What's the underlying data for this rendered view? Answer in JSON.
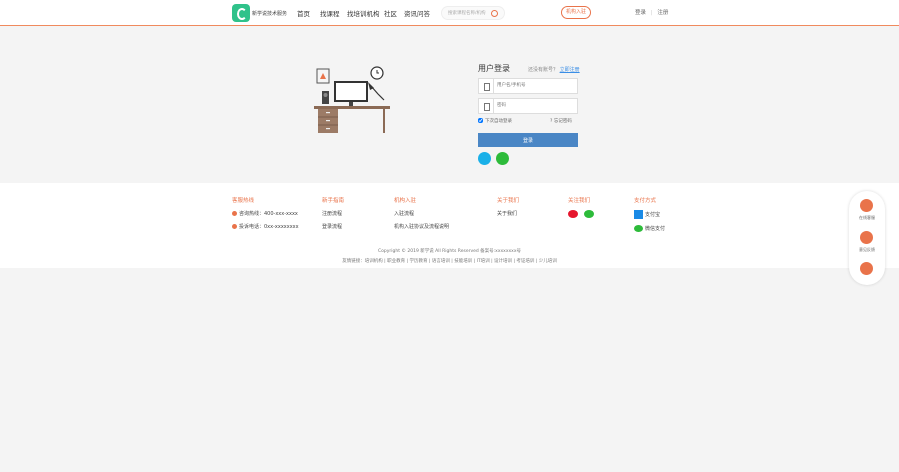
{
  "header": {
    "logo_text": "新学说技术服务",
    "nav": [
      "首页",
      "找课程",
      "找培训机构",
      "社区",
      "资讯问答"
    ],
    "search_placeholder": "搜索课程名称/机构",
    "join_label": "机构入驻",
    "login_link": "登录",
    "register_link": "注册"
  },
  "login": {
    "title": "用户登录",
    "register_prompt": "还没有账号？",
    "register_link": "立即注册",
    "username_placeholder": "用户名/手机号",
    "password_placeholder": "密码",
    "remember_label": "下次自动登录",
    "forgot_label": "忘记密码",
    "submit_label": "登录",
    "colors": {
      "accent": "#e9734a",
      "button": "#4a86c5"
    }
  },
  "footer": {
    "columns": [
      {
        "heading": "客服热线",
        "items": [
          "咨询热线：400-xxx-xxxx",
          "投诉电话：0xx-xxxxxxxx"
        ]
      },
      {
        "heading": "新手指南",
        "items": [
          "注册流程",
          "登录流程"
        ]
      },
      {
        "heading": "机构入驻",
        "items": [
          "入驻流程",
          "机构入驻协议及流程说明"
        ]
      },
      {
        "heading": "关于我们",
        "items": [
          "关于我们"
        ]
      },
      {
        "heading": "关注我们",
        "items": []
      },
      {
        "heading": "支付方式",
        "items": [
          "支付宝",
          "微信支付"
        ]
      }
    ],
    "copyright": "Copyright © 2019 新学说 All Rights Reserved 备案号:xxxxxxxx号",
    "links": "友情链接：培训机构 | 职业教育 | 学历教育 | 语言培训 | 技能培训 | IT培训 | 设计培训 | 考证培训 | 少儿培训"
  },
  "float_bar": {
    "items": [
      "在线客服",
      "意见反馈"
    ]
  }
}
